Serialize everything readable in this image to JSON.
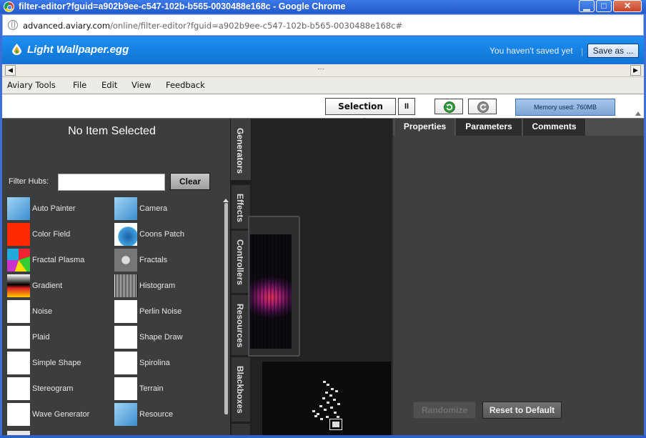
{
  "window": {
    "title": "filter-editor?fguid=a902b9ee-c547-102b-b565-0030488e168c - Google Chrome",
    "min_label": "▁",
    "max_label": "□",
    "close_label": "✕"
  },
  "address": {
    "host": "advanced.aviary.com",
    "path": "/online/filter-editor?fguid=a902b9ee-c547-102b-b565-0030488e168c#"
  },
  "header": {
    "file_name": "Light Wallpaper.egg",
    "save_status": "You haven't saved yet",
    "separator": "|",
    "save_as_label": "Save as ..."
  },
  "menu": {
    "items": [
      "Aviary Tools",
      "File",
      "Edit",
      "View",
      "Feedback"
    ]
  },
  "toolbar": {
    "selection_only_label": "Selection Only",
    "pause_label": "II",
    "memory_label": "Memory used: 760MB"
  },
  "left_panel": {
    "heading": "No Item Selected",
    "filter_label": "Filter Hubs:",
    "filter_value": "",
    "clear_label": "Clear",
    "hubs": [
      {
        "label": "Auto Painter",
        "icon": "auto-painter-icon"
      },
      {
        "label": "Camera",
        "icon": "camera-icon"
      },
      {
        "label": "Color Field",
        "icon": "color-field-icon"
      },
      {
        "label": "Coons Patch",
        "icon": "coons-patch-icon"
      },
      {
        "label": "Fractal Plasma",
        "icon": "fractal-plasma-icon"
      },
      {
        "label": "Fractals",
        "icon": "fractals-icon"
      },
      {
        "label": "Gradient",
        "icon": "gradient-icon"
      },
      {
        "label": "Histogram",
        "icon": "histogram-icon"
      },
      {
        "label": "Noise",
        "icon": "noise-icon"
      },
      {
        "label": "Perlin Noise",
        "icon": "perlin-noise-icon"
      },
      {
        "label": "Plaid",
        "icon": "plaid-icon"
      },
      {
        "label": "Shape Draw",
        "icon": "shape-draw-icon"
      },
      {
        "label": "Simple Shape",
        "icon": "simple-shape-icon"
      },
      {
        "label": "Spirolina",
        "icon": "spirolina-icon"
      },
      {
        "label": "Stereogram",
        "icon": "stereogram-icon"
      },
      {
        "label": "Terrain",
        "icon": "terrain-icon"
      },
      {
        "label": "Wave Generator",
        "icon": "wave-generator-icon"
      },
      {
        "label": "Resource",
        "icon": "resource-icon"
      }
    ]
  },
  "vertical_tabs": [
    "Generators",
    "Effects",
    "Controllers",
    "Resources",
    "Blackboxes"
  ],
  "right_panel": {
    "tabs": [
      "Properties",
      "Parameters",
      "Comments"
    ],
    "randomize_label": "Randomize",
    "reset_label": "Reset to Default"
  },
  "colors": {
    "accent": "#1a86e8",
    "panel": "#3b3d3f",
    "color_field": "#ff2a00"
  }
}
